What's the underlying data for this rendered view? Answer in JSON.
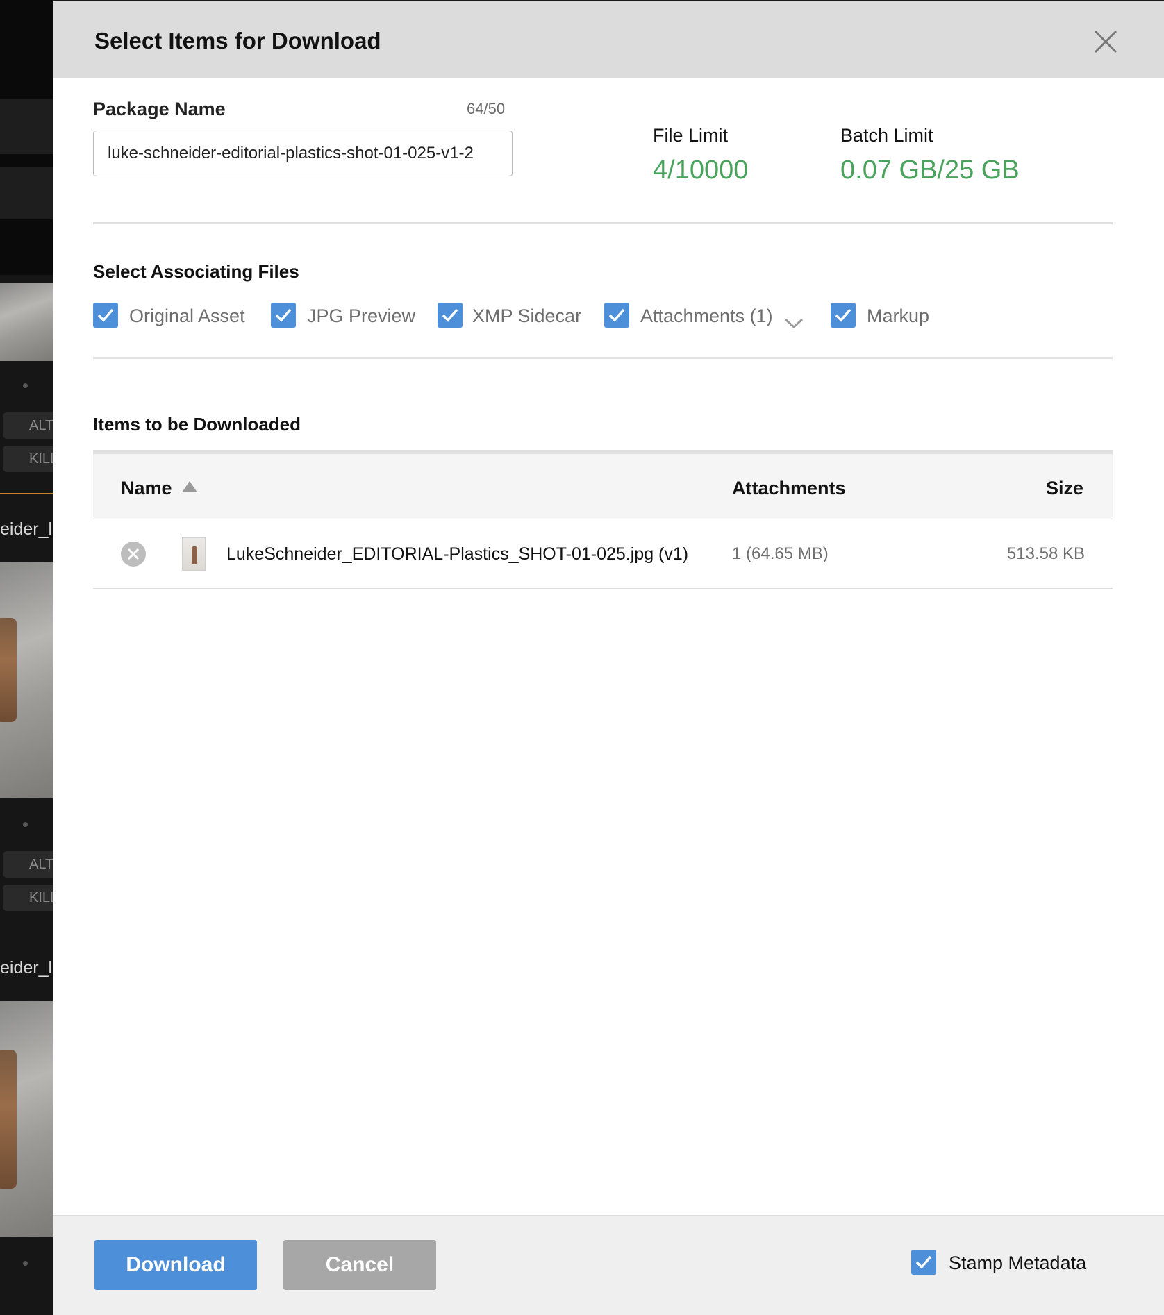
{
  "modal": {
    "title": "Select Items for Download",
    "close_icon": "close-icon"
  },
  "package": {
    "label": "Package Name",
    "counter": "64/50",
    "value": "luke-schneider-editorial-plastics-shot-01-025-v1-2"
  },
  "limits": {
    "file_label": "File Limit",
    "file_value": "4/10000",
    "batch_label": "Batch Limit",
    "batch_value": "0.07 GB/25 GB",
    "value_color": "#4aa35c"
  },
  "associating": {
    "title": "Select Associating Files",
    "options": [
      {
        "label": "Original Asset",
        "checked": true
      },
      {
        "label": "JPG Preview",
        "checked": true
      },
      {
        "label": "XMP Sidecar",
        "checked": true
      },
      {
        "label": "Attachments (1)",
        "checked": true
      },
      {
        "label": "Markup",
        "checked": true
      }
    ]
  },
  "items": {
    "title": "Items to be Downloaded",
    "columns": {
      "name": "Name",
      "attachments": "Attachments",
      "size": "Size"
    },
    "rows": [
      {
        "name": "LukeSchneider_EDITORIAL-Plastics_SHOT-01-025.jpg (v1)",
        "attachments": "1 (64.65 MB)",
        "size": "513.58 KB"
      }
    ]
  },
  "footer": {
    "download_label": "Download",
    "cancel_label": "Cancel",
    "stamp_label": "Stamp Metadata",
    "stamp_checked": true
  },
  "background": {
    "pill_1": "ALT",
    "pill_2": "KILL",
    "filename_1": "eider_l",
    "pill_3": "ALT",
    "pill_4": "KILL",
    "filename_2": "eider_l"
  },
  "colors": {
    "accent": "#4e8fd9",
    "header_bg": "#dcdcdc",
    "footer_bg": "#efefef",
    "cancel_bg": "#a7a7a7"
  }
}
